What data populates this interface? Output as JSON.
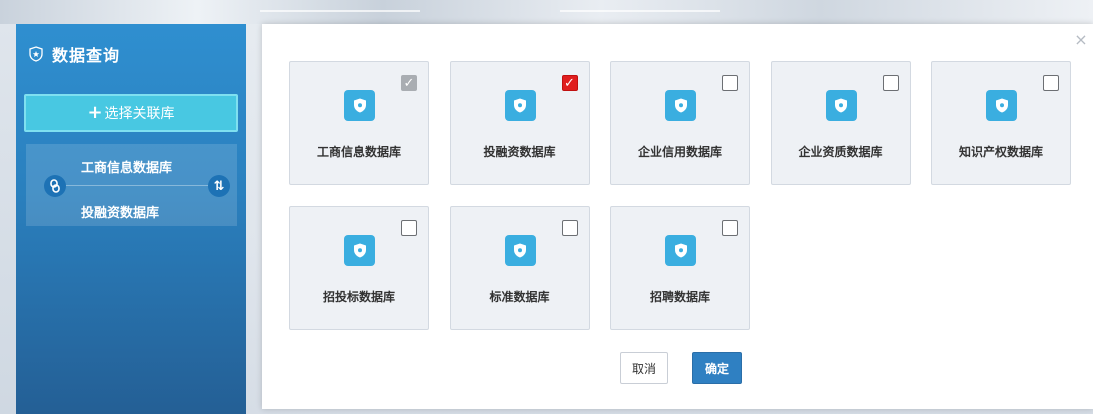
{
  "sidebar": {
    "title": "数据查询",
    "icon": "shield-icon",
    "select_button": {
      "plus": "+",
      "label": "选择关联库"
    },
    "linked": [
      "工商信息数据库",
      "投融资数据库"
    ],
    "swap_symbol": "⇅"
  },
  "dialog": {
    "close_symbol": "×",
    "cards": [
      {
        "label": "工商信息数据库",
        "checked": true,
        "check_style": "gray",
        "mark": "✓"
      },
      {
        "label": "投融资数据库",
        "checked": true,
        "check_style": "red",
        "mark": "✓"
      },
      {
        "label": "企业信用数据库",
        "checked": false,
        "check_style": "",
        "mark": ""
      },
      {
        "label": "企业资质数据库",
        "checked": false,
        "check_style": "",
        "mark": ""
      },
      {
        "label": "知识产权数据库",
        "checked": false,
        "check_style": "",
        "mark": ""
      },
      {
        "label": "招投标数据库",
        "checked": false,
        "check_style": "",
        "mark": ""
      },
      {
        "label": "标准数据库",
        "checked": false,
        "check_style": "",
        "mark": ""
      },
      {
        "label": "招聘数据库",
        "checked": false,
        "check_style": "",
        "mark": ""
      }
    ],
    "cancel_label": "取消",
    "confirm_label": "确定"
  },
  "colors": {
    "sidebar_top": "#2f8fd0",
    "sidebar_bottom": "#245f95",
    "select_button": "#48c8e2",
    "db_icon": "#3aaee0",
    "checked_red": "#e01e1e",
    "checked_gray": "#a9adb2",
    "confirm_button": "#2f80c2"
  }
}
